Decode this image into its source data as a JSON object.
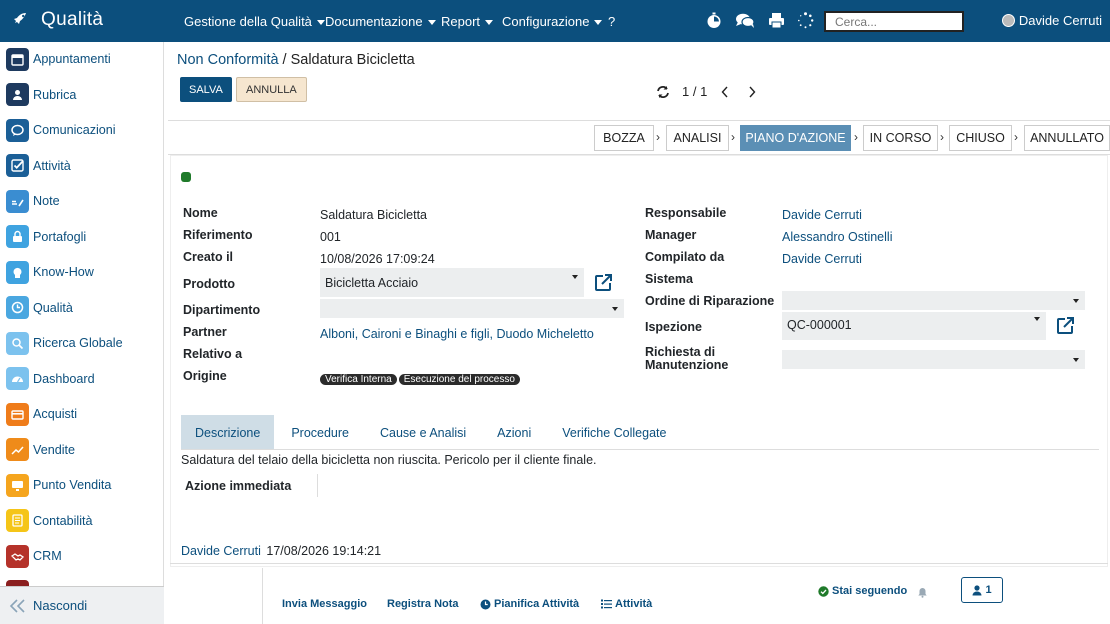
{
  "topbar": {
    "brand": "Qualità",
    "menus": [
      {
        "label": "Gestione della Qualità"
      },
      {
        "label": "Documentazione"
      },
      {
        "label": "Report"
      },
      {
        "label": "Configurazione"
      }
    ],
    "help": "?",
    "search_placeholder": "Cerca...",
    "user": "Davide Cerruti",
    "bg_color": "#0c4f7d"
  },
  "sidebar": {
    "items": [
      {
        "label": "Appuntamenti",
        "icon": "calendar-icon",
        "color": "#1e3a5f"
      },
      {
        "label": "Rubrica",
        "icon": "contacts-icon",
        "color": "#1e3a5f"
      },
      {
        "label": "Comunicazioni",
        "icon": "chat-icon",
        "color": "#1b5f97"
      },
      {
        "label": "Attività",
        "icon": "check-icon",
        "color": "#1b5f97"
      },
      {
        "label": "Note",
        "icon": "note-icon",
        "color": "#3a8dd1"
      },
      {
        "label": "Portafogli",
        "icon": "lock-icon",
        "color": "#3fa3e0"
      },
      {
        "label": "Know-How",
        "icon": "brain-icon",
        "color": "#3fa3e0"
      },
      {
        "label": "Qualità",
        "icon": "quality-icon",
        "color": "#4aa7e0"
      },
      {
        "label": "Ricerca Globale",
        "icon": "search-icon",
        "color": "#7cc2ee"
      },
      {
        "label": "Dashboard",
        "icon": "dashboard-icon",
        "color": "#7cc2ee"
      },
      {
        "label": "Acquisti",
        "icon": "card-icon",
        "color": "#ef7c1a"
      },
      {
        "label": "Vendite",
        "icon": "chart-icon",
        "color": "#ef8b1a"
      },
      {
        "label": "Punto Vendita",
        "icon": "monitor-icon",
        "color": "#f5a51e"
      },
      {
        "label": "Contabilità",
        "icon": "ledger-icon",
        "color": "#f5c518"
      },
      {
        "label": "CRM",
        "icon": "handshake-icon",
        "color": "#b5322a"
      }
    ],
    "hide_label": "Nascondi"
  },
  "breadcrumb": {
    "parent": "Non Conformità",
    "separator": "/",
    "current": "Saldatura Bicicletta"
  },
  "buttons": {
    "save": "SALVA",
    "cancel": "ANNULLA"
  },
  "pager": {
    "value": "1 / 1"
  },
  "status_steps": [
    {
      "label": "BOZZA",
      "active": false
    },
    {
      "label": "ANALISI",
      "active": false
    },
    {
      "label": "PIANO D'AZIONE",
      "active": true
    },
    {
      "label": "IN CORSO",
      "active": false
    },
    {
      "label": "CHIUSO",
      "active": false
    },
    {
      "label": "ANNULLATO",
      "active": false
    }
  ],
  "form": {
    "nome": {
      "label": "Nome",
      "value": "Saldatura Bicicletta"
    },
    "riferimento": {
      "label": "Riferimento",
      "value": "001"
    },
    "creato_il": {
      "label": "Creato il",
      "value": "10/08/2026 17:09:24"
    },
    "prodotto": {
      "label": "Prodotto",
      "value": "Bicicletta Acciaio"
    },
    "dipartimento": {
      "label": "Dipartimento",
      "value": ""
    },
    "partner": {
      "label": "Partner",
      "value": "Alboni, Caironi e Binaghi e figli, Duodo Micheletto"
    },
    "relativo_a": {
      "label": "Relativo a",
      "value": ""
    },
    "origine": {
      "label": "Origine",
      "tags": [
        "Verifica Interna",
        "Esecuzione del processo"
      ]
    },
    "responsabile": {
      "label": "Responsabile",
      "value": "Davide Cerruti"
    },
    "manager": {
      "label": "Manager",
      "value": "Alessandro Ostinelli"
    },
    "compilato_da": {
      "label": "Compilato da",
      "value": "Davide Cerruti"
    },
    "sistema": {
      "label": "Sistema",
      "value": ""
    },
    "ordine_riparazione": {
      "label": "Ordine di Riparazione",
      "value": ""
    },
    "ispezione": {
      "label": "Ispezione",
      "value": "QC-000001"
    },
    "richiesta_manutenzione": {
      "label1": "Richiesta di",
      "label2": "Manutenzione",
      "value": ""
    }
  },
  "tabs": [
    {
      "label": "Descrizione",
      "active": true
    },
    {
      "label": "Procedure"
    },
    {
      "label": "Cause e Analisi"
    },
    {
      "label": "Azioni"
    },
    {
      "label": "Verifiche Collegate"
    }
  ],
  "description": "Saldatura del telaio della bicicletta non riuscita. Pericolo per il cliente finale.",
  "azione_immediata": {
    "label": "Azione immediata",
    "value": ""
  },
  "log": {
    "author": "Davide Cerruti",
    "datetime": "17/08/2026 19:14:21"
  },
  "chatter": {
    "send_message": "Invia Messaggio",
    "log_note": "Registra Nota",
    "schedule": "Pianifica Attività",
    "activities": "Attività",
    "following": "Stai seguendo",
    "followers": "1"
  },
  "status_color": "#1f7a2a",
  "accent": "#0c4f7d",
  "active_step_color": "#5b8fb5"
}
